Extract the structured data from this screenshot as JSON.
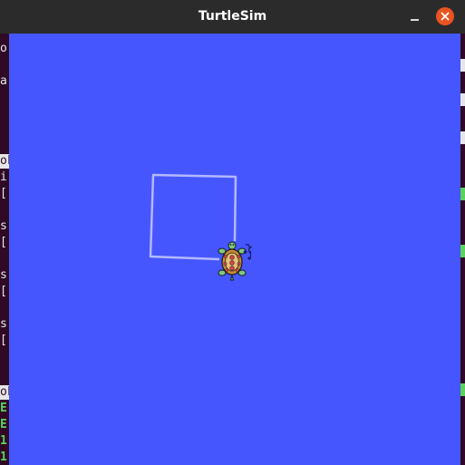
{
  "window": {
    "title": "TurtleSim",
    "background_color": "#4556ff",
    "pen_color": "#b3b8ff",
    "close_button_color": "#e95420"
  },
  "background_terminal": {
    "visible_chars": [
      "o",
      "a",
      "ok",
      "i",
      "[",
      "s",
      "[",
      "s",
      "[",
      "s",
      "[",
      "ok",
      "E",
      "E",
      "1",
      "1"
    ]
  },
  "icons": {
    "minimize": "minimize-icon",
    "close": "close-icon",
    "turtle": "turtle-icon"
  }
}
